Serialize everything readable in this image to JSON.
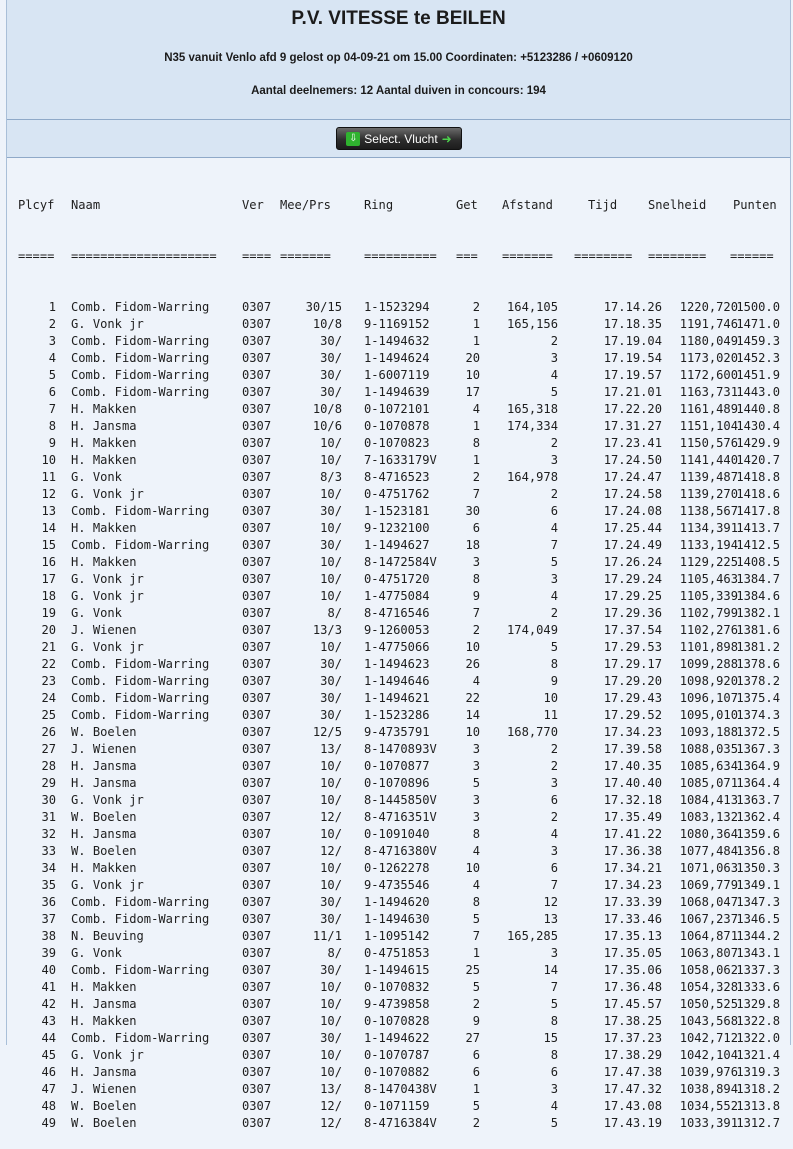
{
  "header": {
    "title": "P.V. VITESSE te BEILEN",
    "race_info": "N35 vanuit Venlo afd 9 gelost op 04-09-21 om 15.00 Coordinaten: +5123286 / +0609120",
    "counts": "Aantal deelnemers: 12 Aantal duiven in concours: 194"
  },
  "button": {
    "label": "Select. Vlucht"
  },
  "columns": [
    "Plcyf",
    "Naam",
    "Ver",
    "Mee/Prs",
    "Ring",
    "Get",
    "Afstand",
    "Tijd",
    "Snelheid",
    "Punten"
  ],
  "separators": [
    "=====",
    "====================",
    "====",
    "=======",
    "==========",
    "===",
    "=======",
    "========",
    "========",
    "======"
  ],
  "rows": [
    [
      "1",
      "Comb. Fidom-Warring",
      "0307",
      "30/15",
      "1-1523294",
      "2",
      "164,105",
      "17.14.26",
      "1220,720",
      "1500.0"
    ],
    [
      "2",
      "G. Vonk jr",
      "0307",
      "10/8",
      "9-1169152",
      "1",
      "165,156",
      "17.18.35",
      "1191,746",
      "1471.0"
    ],
    [
      "3",
      "Comb. Fidom-Warring",
      "0307",
      "30/",
      "1-1494632",
      "1",
      "2",
      "17.19.04",
      "1180,049",
      "1459.3"
    ],
    [
      "4",
      "Comb. Fidom-Warring",
      "0307",
      "30/",
      "1-1494624",
      "20",
      "3",
      "17.19.54",
      "1173,020",
      "1452.3"
    ],
    [
      "5",
      "Comb. Fidom-Warring",
      "0307",
      "30/",
      "1-6007119",
      "10",
      "4",
      "17.19.57",
      "1172,600",
      "1451.9"
    ],
    [
      "6",
      "Comb. Fidom-Warring",
      "0307",
      "30/",
      "1-1494639",
      "17",
      "5",
      "17.21.01",
      "1163,731",
      "1443.0"
    ],
    [
      "7",
      "H. Makken",
      "0307",
      "10/8",
      "0-1072101",
      "4",
      "165,318",
      "17.22.20",
      "1161,489",
      "1440.8"
    ],
    [
      "8",
      "H. Jansma",
      "0307",
      "10/6",
      "0-1070878",
      "1",
      "174,334",
      "17.31.27",
      "1151,104",
      "1430.4"
    ],
    [
      "9",
      "H. Makken",
      "0307",
      "10/",
      "0-1070823",
      "8",
      "2",
      "17.23.41",
      "1150,576",
      "1429.9"
    ],
    [
      "10",
      "H. Makken",
      "0307",
      "10/",
      "7-1633179V",
      "1",
      "3",
      "17.24.50",
      "1141,440",
      "1420.7"
    ],
    [
      "11",
      "G. Vonk",
      "0307",
      "8/3",
      "8-4716523",
      "2",
      "164,978",
      "17.24.47",
      "1139,487",
      "1418.8"
    ],
    [
      "12",
      "G. Vonk jr",
      "0307",
      "10/",
      "0-4751762",
      "7",
      "2",
      "17.24.58",
      "1139,270",
      "1418.6"
    ],
    [
      "13",
      "Comb. Fidom-Warring",
      "0307",
      "30/",
      "1-1523181",
      "30",
      "6",
      "17.24.08",
      "1138,567",
      "1417.8"
    ],
    [
      "14",
      "H. Makken",
      "0307",
      "10/",
      "9-1232100",
      "6",
      "4",
      "17.25.44",
      "1134,391",
      "1413.7"
    ],
    [
      "15",
      "Comb. Fidom-Warring",
      "0307",
      "30/",
      "1-1494627",
      "18",
      "7",
      "17.24.49",
      "1133,194",
      "1412.5"
    ],
    [
      "16",
      "H. Makken",
      "0307",
      "10/",
      "8-1472584V",
      "3",
      "5",
      "17.26.24",
      "1129,225",
      "1408.5"
    ],
    [
      "17",
      "G. Vonk jr",
      "0307",
      "10/",
      "0-4751720",
      "8",
      "3",
      "17.29.24",
      "1105,463",
      "1384.7"
    ],
    [
      "18",
      "G. Vonk jr",
      "0307",
      "10/",
      "1-4775084",
      "9",
      "4",
      "17.29.25",
      "1105,339",
      "1384.6"
    ],
    [
      "19",
      "G. Vonk",
      "0307",
      "8/",
      "8-4716546",
      "7",
      "2",
      "17.29.36",
      "1102,799",
      "1382.1"
    ],
    [
      "20",
      "J. Wienen",
      "0307",
      "13/3",
      "9-1260053",
      "2",
      "174,049",
      "17.37.54",
      "1102,276",
      "1381.6"
    ],
    [
      "21",
      "G. Vonk jr",
      "0307",
      "10/",
      "1-4775066",
      "10",
      "5",
      "17.29.53",
      "1101,898",
      "1381.2"
    ],
    [
      "22",
      "Comb. Fidom-Warring",
      "0307",
      "30/",
      "1-1494623",
      "26",
      "8",
      "17.29.17",
      "1099,288",
      "1378.6"
    ],
    [
      "23",
      "Comb. Fidom-Warring",
      "0307",
      "30/",
      "1-1494646",
      "4",
      "9",
      "17.29.20",
      "1098,920",
      "1378.2"
    ],
    [
      "24",
      "Comb. Fidom-Warring",
      "0307",
      "30/",
      "1-1494621",
      "22",
      "10",
      "17.29.43",
      "1096,107",
      "1375.4"
    ],
    [
      "25",
      "Comb. Fidom-Warring",
      "0307",
      "30/",
      "1-1523286",
      "14",
      "11",
      "17.29.52",
      "1095,010",
      "1374.3"
    ],
    [
      "26",
      "W. Boelen",
      "0307",
      "12/5",
      "9-4735791",
      "10",
      "168,770",
      "17.34.23",
      "1093,188",
      "1372.5"
    ],
    [
      "27",
      "J. Wienen",
      "0307",
      "13/",
      "8-1470893V",
      "3",
      "2",
      "17.39.58",
      "1088,035",
      "1367.3"
    ],
    [
      "28",
      "H. Jansma",
      "0307",
      "10/",
      "0-1070877",
      "3",
      "2",
      "17.40.35",
      "1085,634",
      "1364.9"
    ],
    [
      "29",
      "H. Jansma",
      "0307",
      "10/",
      "0-1070896",
      "5",
      "3",
      "17.40.40",
      "1085,071",
      "1364.4"
    ],
    [
      "30",
      "G. Vonk jr",
      "0307",
      "10/",
      "8-1445850V",
      "3",
      "6",
      "17.32.18",
      "1084,413",
      "1363.7"
    ],
    [
      "31",
      "W. Boelen",
      "0307",
      "12/",
      "8-4716351V",
      "3",
      "2",
      "17.35.49",
      "1083,132",
      "1362.4"
    ],
    [
      "32",
      "H. Jansma",
      "0307",
      "10/",
      "0-1091040",
      "8",
      "4",
      "17.41.22",
      "1080,364",
      "1359.6"
    ],
    [
      "33",
      "W. Boelen",
      "0307",
      "12/",
      "8-4716380V",
      "4",
      "3",
      "17.36.38",
      "1077,484",
      "1356.8"
    ],
    [
      "34",
      "H. Makken",
      "0307",
      "10/",
      "0-1262278",
      "10",
      "6",
      "17.34.21",
      "1071,063",
      "1350.3"
    ],
    [
      "35",
      "G. Vonk jr",
      "0307",
      "10/",
      "9-4735546",
      "4",
      "7",
      "17.34.23",
      "1069,779",
      "1349.1"
    ],
    [
      "36",
      "Comb. Fidom-Warring",
      "0307",
      "30/",
      "1-1494620",
      "8",
      "12",
      "17.33.39",
      "1068,047",
      "1347.3"
    ],
    [
      "37",
      "Comb. Fidom-Warring",
      "0307",
      "30/",
      "1-1494630",
      "5",
      "13",
      "17.33.46",
      "1067,237",
      "1346.5"
    ],
    [
      "38",
      "N. Beuving",
      "0307",
      "11/1",
      "1-1095142",
      "7",
      "165,285",
      "17.35.13",
      "1064,871",
      "1344.2"
    ],
    [
      "39",
      "G. Vonk",
      "0307",
      "8/",
      "0-4751853",
      "1",
      "3",
      "17.35.05",
      "1063,807",
      "1343.1"
    ],
    [
      "40",
      "Comb. Fidom-Warring",
      "0307",
      "30/",
      "1-1494615",
      "25",
      "14",
      "17.35.06",
      "1058,062",
      "1337.3"
    ],
    [
      "41",
      "H. Makken",
      "0307",
      "10/",
      "0-1070832",
      "5",
      "7",
      "17.36.48",
      "1054,328",
      "1333.6"
    ],
    [
      "42",
      "H. Jansma",
      "0307",
      "10/",
      "9-4739858",
      "2",
      "5",
      "17.45.57",
      "1050,525",
      "1329.8"
    ],
    [
      "43",
      "H. Makken",
      "0307",
      "10/",
      "0-1070828",
      "9",
      "8",
      "17.38.25",
      "1043,568",
      "1322.8"
    ],
    [
      "44",
      "Comb. Fidom-Warring",
      "0307",
      "30/",
      "1-1494622",
      "27",
      "15",
      "17.37.23",
      "1042,712",
      "1322.0"
    ],
    [
      "45",
      "G. Vonk jr",
      "0307",
      "10/",
      "0-1070787",
      "6",
      "8",
      "17.38.29",
      "1042,104",
      "1321.4"
    ],
    [
      "46",
      "H. Jansma",
      "0307",
      "10/",
      "0-1070882",
      "6",
      "6",
      "17.47.38",
      "1039,976",
      "1319.3"
    ],
    [
      "47",
      "J. Wienen",
      "0307",
      "13/",
      "8-1470438V",
      "1",
      "3",
      "17.47.32",
      "1038,894",
      "1318.2"
    ],
    [
      "48",
      "W. Boelen",
      "0307",
      "12/",
      "0-1071159",
      "5",
      "4",
      "17.43.08",
      "1034,552",
      "1313.8"
    ],
    [
      "49",
      "W. Boelen",
      "0307",
      "12/",
      "8-4716384V",
      "2",
      "5",
      "17.43.19",
      "1033,391",
      "1312.7"
    ]
  ]
}
